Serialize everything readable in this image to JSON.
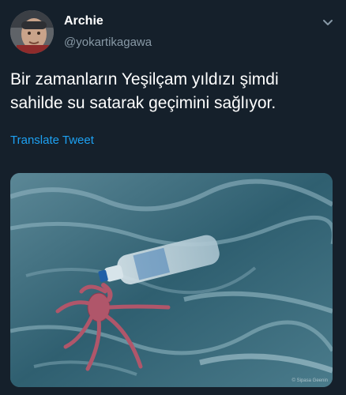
{
  "tweet": {
    "author_name": "Archie",
    "author_handle": "@yokartikagawa",
    "text": "Bir zamanların Yeşilçam yıldızı şimdi sahilde su satarak geçimini sağlıyor.",
    "translate_label": "Translate Tweet"
  },
  "media": {
    "watermark": "© Sipasa Geenin"
  },
  "colors": {
    "background": "#15202b",
    "primary_text": "#ffffff",
    "secondary_text": "#8899a6",
    "link": "#1da1f2"
  },
  "icons": {
    "menu": "chevron-down-icon"
  }
}
